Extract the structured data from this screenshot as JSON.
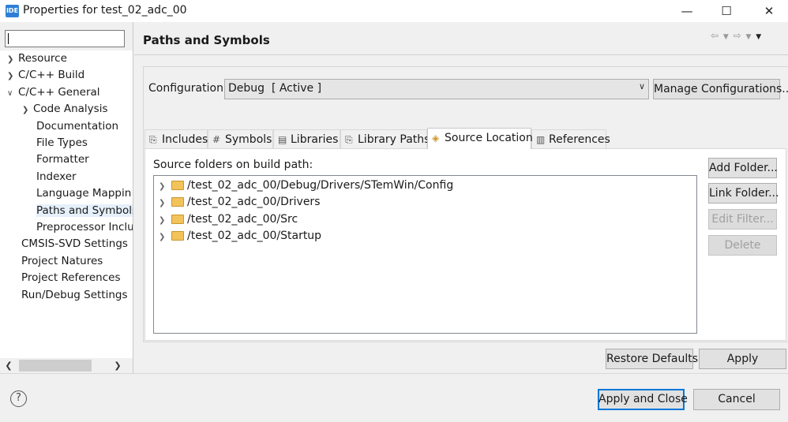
{
  "window": {
    "title": "Properties for test_02_adc_00",
    "app_icon_label": "IDE",
    "minimize_icon": "minimize-icon",
    "maximize_icon": "maximize-icon",
    "close_icon": "close-icon"
  },
  "filter": {
    "value": "",
    "placeholder": ""
  },
  "tree": {
    "items": [
      {
        "label": "Resource",
        "level": 0,
        "expander": "collapsed"
      },
      {
        "label": "C/C++ Build",
        "level": 0,
        "expander": "collapsed"
      },
      {
        "label": "C/C++ General",
        "level": 0,
        "expander": "expanded"
      },
      {
        "label": "Code Analysis",
        "level": 1,
        "expander": "collapsed"
      },
      {
        "label": "Documentation",
        "level": 1,
        "expander": "none"
      },
      {
        "label": "File Types",
        "level": 1,
        "expander": "none"
      },
      {
        "label": "Formatter",
        "level": 1,
        "expander": "none"
      },
      {
        "label": "Indexer",
        "level": 1,
        "expander": "none"
      },
      {
        "label": "Language Mappin",
        "level": 1,
        "expander": "none"
      },
      {
        "label": "Paths and Symbols",
        "level": 1,
        "expander": "none",
        "selected": true
      },
      {
        "label": "Preprocessor Inclu",
        "level": 1,
        "expander": "none"
      },
      {
        "label": "CMSIS-SVD Settings",
        "level": 0,
        "expander": "none"
      },
      {
        "label": "Project Natures",
        "level": 0,
        "expander": "none"
      },
      {
        "label": "Project References",
        "level": 0,
        "expander": "none"
      },
      {
        "label": "Run/Debug Settings",
        "level": 0,
        "expander": "none"
      }
    ]
  },
  "page": {
    "title": "Paths and Symbols",
    "nav_back_icon": "back-arrow-icon",
    "nav_forward_icon": "forward-arrow-icon"
  },
  "configuration": {
    "label": "Configuration:",
    "selected": "Debug  [ Active ]",
    "manage_button": "Manage Configurations..."
  },
  "tabs": [
    {
      "label": "Includes",
      "icon": "includes-icon"
    },
    {
      "label": "Symbols",
      "icon": "hash-icon"
    },
    {
      "label": "Libraries",
      "icon": "libraries-icon"
    },
    {
      "label": "Library Paths",
      "icon": "library-paths-icon"
    },
    {
      "label": "Source Location",
      "icon": "source-folder-icon",
      "active": true
    },
    {
      "label": "References",
      "icon": "references-icon"
    }
  ],
  "source_location": {
    "list_label": "Source folders on build path:",
    "folders": [
      "/test_02_adc_00/Debug/Drivers/STemWin/Config",
      "/test_02_adc_00/Drivers",
      "/test_02_adc_00/Src",
      "/test_02_adc_00/Startup"
    ],
    "buttons": {
      "add_folder": "Add Folder...",
      "link_folder": "Link Folder...",
      "edit_filter": "Edit Filter...",
      "delete": "Delete"
    }
  },
  "footer": {
    "restore_defaults": "Restore Defaults",
    "apply": "Apply",
    "apply_and_close": "Apply and Close",
    "cancel": "Cancel",
    "help_icon": "help-icon"
  }
}
